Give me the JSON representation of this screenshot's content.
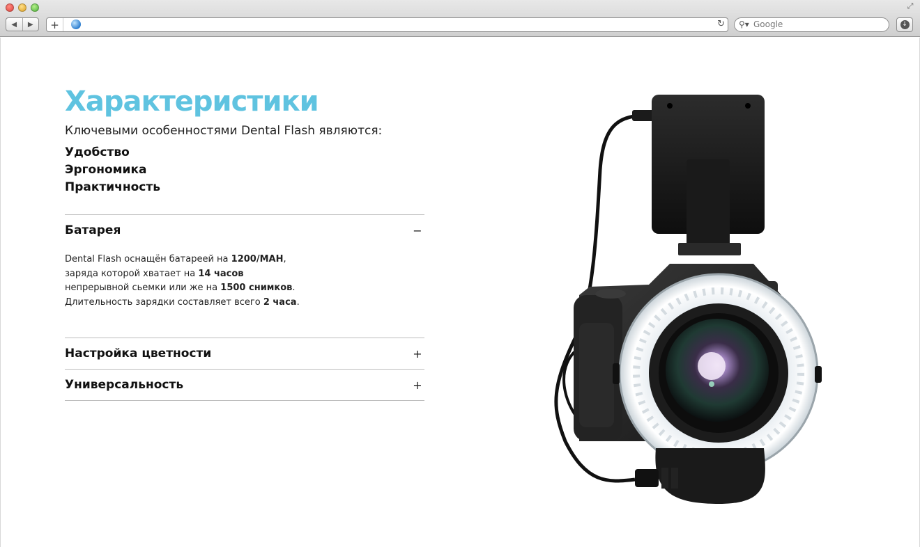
{
  "browser": {
    "url": "",
    "search_placeholder": "Google",
    "back_glyph": "◀",
    "forward_glyph": "▶",
    "new_tab_glyph": "+",
    "reload_glyph": "↻",
    "search_glyph": "⚲▾",
    "download_glyph": "↓",
    "resize_glyph": "⤢"
  },
  "page": {
    "title": "Характеристики",
    "lead": "Ключевыми особенностями Dental Flash являются:",
    "features": [
      "Удобство",
      "Эргономика",
      "Практичность"
    ],
    "accordion": [
      {
        "title": "Батарея",
        "toggle": "−",
        "expanded": true,
        "body": {
          "l1a": "Dental Flash оснащён батареей на ",
          "l1b": "1200/MAH",
          "l1c": ",",
          "l2a": "заряда которой хватает на ",
          "l2b": "14 часов",
          "l3a": "непрерывной сьемки или же на ",
          "l3b": "1500 снимков",
          "l3c": ".",
          "l4a": "Длительность зарядки составляет всего ",
          "l4b": "2 часа",
          "l4c": "."
        }
      },
      {
        "title": "Настройка цветности",
        "toggle": "+",
        "expanded": false
      },
      {
        "title": "Универсальность",
        "toggle": "+",
        "expanded": false
      }
    ]
  },
  "colors": {
    "title": "#5fc3e0",
    "divider": "#bdbdbd"
  },
  "image": {
    "subject": "camera-with-ring-flash"
  }
}
